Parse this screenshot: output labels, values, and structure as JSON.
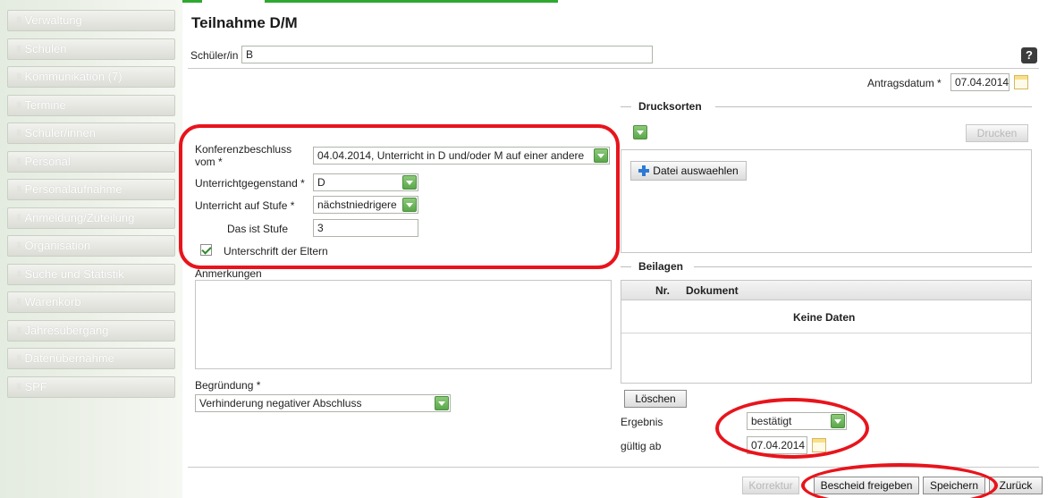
{
  "sidebar": {
    "items": [
      {
        "label": "Verwaltung"
      },
      {
        "label": "Schulen"
      },
      {
        "label": "Kommunikation (7)"
      },
      {
        "label": "Termine"
      },
      {
        "label": "Schüler/innen"
      },
      {
        "label": "Personal"
      },
      {
        "label": "Personalaufnahme"
      },
      {
        "label": "Anmeldung/Zuteilung"
      },
      {
        "label": "Organisation"
      },
      {
        "label": "Suche und Statistik"
      },
      {
        "label": "Warenkorb"
      },
      {
        "label": "Jahresübergang"
      },
      {
        "label": "Datenübernahme"
      },
      {
        "label": "SPF"
      }
    ]
  },
  "page": {
    "title": "Teilnahme D/M",
    "student_label": "Schüler/in",
    "student_value": "B",
    "antragsdatum_label": "Antragsdatum *",
    "antragsdatum_value": "07.04.2014"
  },
  "form": {
    "konferenz_label_1": "Konferenzbeschluss",
    "konferenz_label_2": "vom *",
    "konferenz_value": "04.04.2014, Unterricht in D und/oder M auf einer andere",
    "gegenstand_label": "Unterrichtgegenstand *",
    "gegenstand_value": "D",
    "stufe_label": "Unterricht auf Stufe *",
    "stufe_value": "nächstniedrigere",
    "das_ist_stufe_label": "Das ist Stufe",
    "das_ist_stufe_value": "3",
    "unterschrift_label": "Unterschrift der Eltern",
    "anmerkungen_label": "Anmerkungen",
    "begruendung_label": "Begründung *",
    "begruendung_value": "Verhinderung negativer Abschluss"
  },
  "drucksorten": {
    "title": "Drucksorten",
    "print_button": "Drucken",
    "file_button": "Datei auswaehlen"
  },
  "beilagen": {
    "title": "Beilagen",
    "columns": [
      "Nr.",
      "Dokument"
    ],
    "empty_text": "Keine Daten",
    "delete_button": "Löschen"
  },
  "ergebnis": {
    "label": "Ergebnis",
    "value": "bestätigt",
    "gueltig_label": "gültig ab",
    "gueltig_value": "07.04.2014"
  },
  "footer": {
    "korrektur": "Korrektur",
    "freigeben": "Bescheid freigeben",
    "speichern": "Speichern",
    "zurueck": "Zurück"
  }
}
